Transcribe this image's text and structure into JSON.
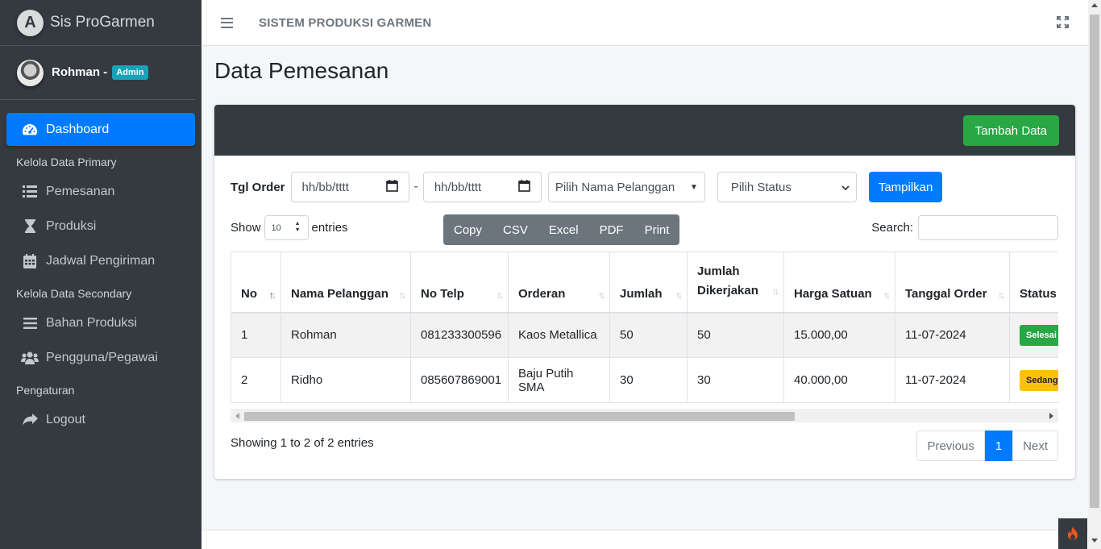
{
  "app": {
    "brand": "Sis ProGarmen",
    "brand_initial": "A"
  },
  "user": {
    "name": "Rohman -",
    "role": "Admin"
  },
  "sidebar": {
    "items": [
      {
        "label": "Dashboard",
        "icon": "tachometer-icon",
        "active": true
      },
      {
        "header": "Kelola Data Primary"
      },
      {
        "label": "Pemesanan",
        "icon": "list-icon"
      },
      {
        "label": "Produksi",
        "icon": "hourglass-icon"
      },
      {
        "label": "Jadwal Pengiriman",
        "icon": "calendar-icon"
      },
      {
        "header": "Kelola Data Secondary"
      },
      {
        "label": "Bahan Produksi",
        "icon": "bars-icon"
      },
      {
        "label": "Pengguna/Pegawai",
        "icon": "users-icon"
      },
      {
        "header": "Pengaturan"
      },
      {
        "label": "Logout",
        "icon": "share-icon"
      }
    ]
  },
  "topbar": {
    "title": "SISTEM PRODUKSI GARMEN"
  },
  "page": {
    "title": "Data Pemesanan"
  },
  "card": {
    "add_button": "Tambah Data"
  },
  "filter": {
    "label": "Tgl Order",
    "date_from_placeholder": "hh/bb/tttt",
    "separator": "-",
    "date_to_placeholder": "hh/bb/tttt",
    "customer_select": "Pilih Nama Pelanggan",
    "status_select": "Pilih Status",
    "submit": "Tampilkan"
  },
  "table_controls": {
    "show_label": "Show",
    "length_value": "10",
    "entries_label": "entries",
    "export_buttons": [
      "Copy",
      "CSV",
      "Excel",
      "PDF",
      "Print"
    ],
    "search_label": "Search:"
  },
  "table": {
    "columns": [
      "No",
      "Nama Pelanggan",
      "No Telp",
      "Orderan",
      "Jumlah",
      "Jumlah Dikerjakan",
      "Harga Satuan",
      "Tanggal Order",
      "Status"
    ],
    "rows": [
      {
        "no": "1",
        "nama": "Rohman",
        "telp": "081233300596",
        "orderan": "Kaos Metallica",
        "jumlah": "50",
        "dikerjakan": "50",
        "harga": "15.000,00",
        "tanggal": "11-07-2024",
        "status": "Selesai",
        "status_color": "#28a745"
      },
      {
        "no": "2",
        "nama": "Ridho",
        "telp": "085607869001",
        "orderan": "Baju Putih SMA",
        "jumlah": "30",
        "dikerjakan": "30",
        "harga": "40.000,00",
        "tanggal": "11-07-2024",
        "status": "Sedang",
        "status_color": "#ffc107"
      }
    ]
  },
  "footer": {
    "info": "Showing 1 to 2 of 2 entries",
    "prev": "Previous",
    "page": "1",
    "next": "Next"
  },
  "colors": {
    "sidebar": "#343a40",
    "primary": "#007bff",
    "success": "#28a745",
    "warning": "#ffc107",
    "export_group": "#6c757d"
  }
}
